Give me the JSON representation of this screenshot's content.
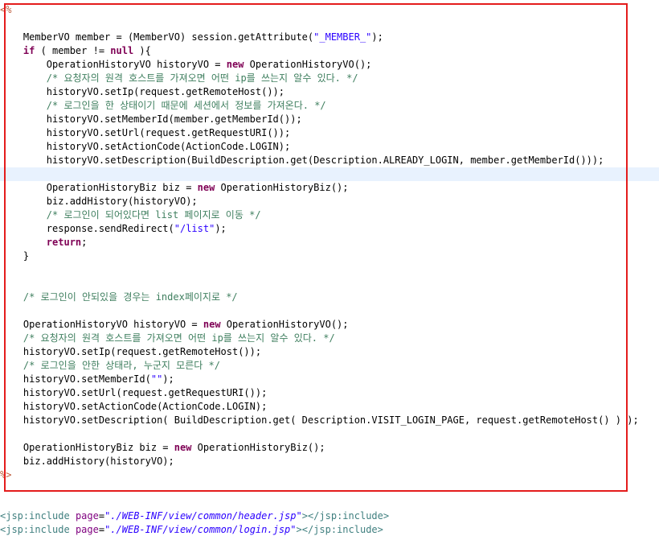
{
  "highlight": {
    "color": "#e41c1c"
  },
  "current_line_index": 12,
  "lines": [
    [
      {
        "t": "scriptlet",
        "v": "<%"
      }
    ],
    [],
    [
      {
        "t": "plain",
        "v": "    MemberVO member = (MemberVO) session.getAttribute("
      },
      {
        "t": "str",
        "v": "\"_MEMBER_\""
      },
      {
        "t": "plain",
        "v": ");"
      }
    ],
    [
      {
        "t": "plain",
        "v": "    "
      },
      {
        "t": "kw",
        "v": "if"
      },
      {
        "t": "plain",
        "v": " ( member != "
      },
      {
        "t": "kw",
        "v": "null"
      },
      {
        "t": "plain",
        "v": " ){"
      }
    ],
    [
      {
        "t": "plain",
        "v": "        OperationHistoryVO historyVO = "
      },
      {
        "t": "kw",
        "v": "new"
      },
      {
        "t": "plain",
        "v": " OperationHistoryVO();"
      }
    ],
    [
      {
        "t": "plain",
        "v": "        "
      },
      {
        "t": "comment",
        "v": "/* 요청자의 원격 호스트를 가져오면 어떤 ip를 쓰는지 알수 있다. */"
      }
    ],
    [
      {
        "t": "plain",
        "v": "        historyVO.setIp(request.getRemoteHost());"
      }
    ],
    [
      {
        "t": "plain",
        "v": "        "
      },
      {
        "t": "comment",
        "v": "/* 로그인을 한 상태이기 때문에 세션에서 정보를 가져온다. */"
      }
    ],
    [
      {
        "t": "plain",
        "v": "        historyVO.setMemberId(member.getMemberId());"
      }
    ],
    [
      {
        "t": "plain",
        "v": "        historyVO.setUrl(request.getRequestURI());"
      }
    ],
    [
      {
        "t": "plain",
        "v": "        historyVO.setActionCode(ActionCode.LOGIN);"
      }
    ],
    [
      {
        "t": "plain",
        "v": "        historyVO.setDescription(BuildDescription.get(Description.ALREADY_LOGIN, member.getMemberId()));"
      }
    ],
    [],
    [
      {
        "t": "plain",
        "v": "        OperationHistoryBiz biz = "
      },
      {
        "t": "kw",
        "v": "new"
      },
      {
        "t": "plain",
        "v": " OperationHistoryBiz();"
      }
    ],
    [
      {
        "t": "plain",
        "v": "        biz.addHistory(historyVO);"
      }
    ],
    [
      {
        "t": "plain",
        "v": "        "
      },
      {
        "t": "comment",
        "v": "/* 로그인이 되어있다면 list 페이지로 이동 */"
      }
    ],
    [
      {
        "t": "plain",
        "v": "        response.sendRedirect("
      },
      {
        "t": "str",
        "v": "\"/list\""
      },
      {
        "t": "plain",
        "v": ");"
      }
    ],
    [
      {
        "t": "plain",
        "v": "        "
      },
      {
        "t": "kw",
        "v": "return"
      },
      {
        "t": "plain",
        "v": ";"
      }
    ],
    [
      {
        "t": "plain",
        "v": "    }"
      }
    ],
    [],
    [],
    [
      {
        "t": "plain",
        "v": "    "
      },
      {
        "t": "comment",
        "v": "/* 로그인이 안되있을 경우는 index페이지로 */"
      }
    ],
    [],
    [
      {
        "t": "plain",
        "v": "    OperationHistoryVO historyVO = "
      },
      {
        "t": "kw",
        "v": "new"
      },
      {
        "t": "plain",
        "v": " OperationHistoryVO();"
      }
    ],
    [
      {
        "t": "plain",
        "v": "    "
      },
      {
        "t": "comment",
        "v": "/* 요청자의 원격 호스트를 가져오면 어떤 ip를 쓰는지 알수 있다. */"
      }
    ],
    [
      {
        "t": "plain",
        "v": "    historyVO.setIp(request.getRemoteHost());"
      }
    ],
    [
      {
        "t": "plain",
        "v": "    "
      },
      {
        "t": "comment",
        "v": "/* 로그인을 안한 상태라, 누군지 모른다 */"
      }
    ],
    [
      {
        "t": "plain",
        "v": "    historyVO.setMemberId("
      },
      {
        "t": "str",
        "v": "\"\""
      },
      {
        "t": "plain",
        "v": ");"
      }
    ],
    [
      {
        "t": "plain",
        "v": "    historyVO.setUrl(request.getRequestURI());"
      }
    ],
    [
      {
        "t": "plain",
        "v": "    historyVO.setActionCode(ActionCode.LOGIN);"
      }
    ],
    [
      {
        "t": "plain",
        "v": "    historyVO.setDescription( BuildDescription.get( Description.VISIT_LOGIN_PAGE, request.getRemoteHost() ) );"
      }
    ],
    [],
    [
      {
        "t": "plain",
        "v": "    OperationHistoryBiz biz = "
      },
      {
        "t": "kw",
        "v": "new"
      },
      {
        "t": "plain",
        "v": " OperationHistoryBiz();"
      }
    ],
    [
      {
        "t": "plain",
        "v": "    biz.addHistory(historyVO);"
      }
    ],
    [
      {
        "t": "scriptlet",
        "v": "%>"
      }
    ],
    [],
    [],
    [
      {
        "t": "tag",
        "v": "<jsp:include"
      },
      {
        "t": "plain",
        "v": " "
      },
      {
        "t": "attr",
        "v": "page"
      },
      {
        "t": "plain",
        "v": "="
      },
      {
        "t": "attrval",
        "v": "\"./WEB-INF/view/common/header.jsp\""
      },
      {
        "t": "tag",
        "v": "></jsp:include>"
      }
    ],
    [
      {
        "t": "tag",
        "v": "<jsp:include"
      },
      {
        "t": "plain",
        "v": " "
      },
      {
        "t": "attr",
        "v": "page"
      },
      {
        "t": "plain",
        "v": "="
      },
      {
        "t": "attrval",
        "v": "\"./WEB-INF/view/common/login.jsp\""
      },
      {
        "t": "tag",
        "v": "></jsp:include>"
      }
    ]
  ]
}
